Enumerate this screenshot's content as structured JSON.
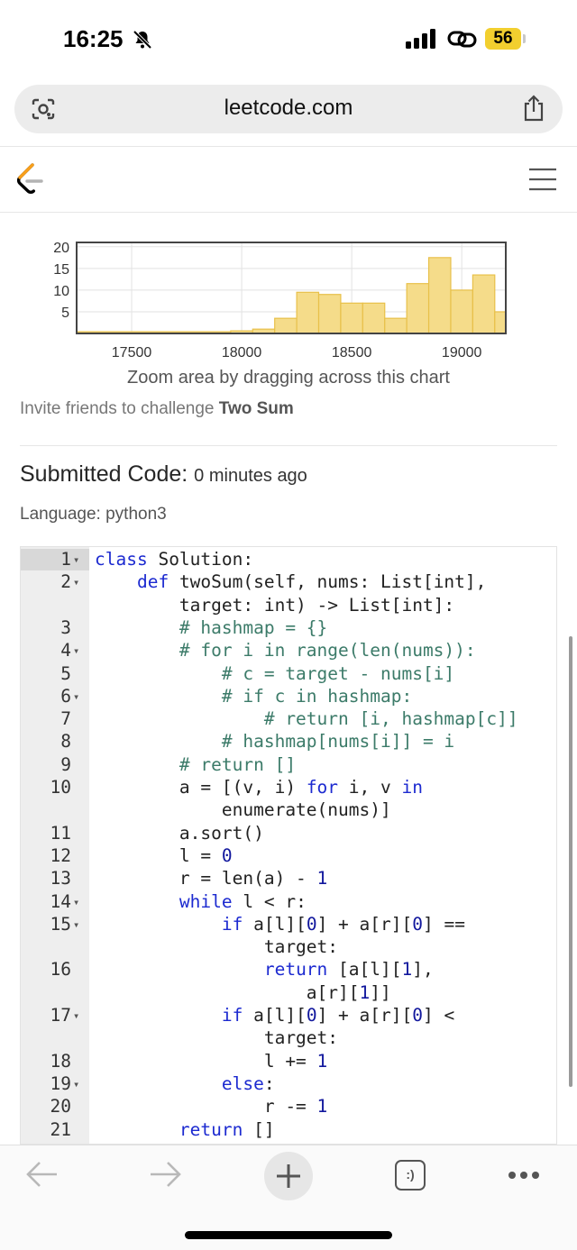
{
  "status_bar": {
    "time": "16:25",
    "battery": "56"
  },
  "browser": {
    "url": "leetcode.com"
  },
  "chart_data": {
    "type": "bar",
    "x_ticks": [
      17500,
      18000,
      18500,
      19000
    ],
    "y_ticks": [
      5,
      10,
      15,
      20
    ],
    "xlim": [
      17250,
      19200
    ],
    "ylim": [
      0,
      21
    ],
    "bins": [
      {
        "x0": 17250,
        "x1": 17950,
        "value": 0.4
      },
      {
        "x0": 17950,
        "x1": 18050,
        "value": 0.6
      },
      {
        "x0": 18050,
        "x1": 18150,
        "value": 1
      },
      {
        "x0": 18150,
        "x1": 18250,
        "value": 3.5
      },
      {
        "x0": 18250,
        "x1": 18350,
        "value": 9.5
      },
      {
        "x0": 18350,
        "x1": 18450,
        "value": 9
      },
      {
        "x0": 18450,
        "x1": 18550,
        "value": 7
      },
      {
        "x0": 18550,
        "x1": 18650,
        "value": 7
      },
      {
        "x0": 18650,
        "x1": 18750,
        "value": 3.5
      },
      {
        "x0": 18750,
        "x1": 18850,
        "value": 11.5
      },
      {
        "x0": 18850,
        "x1": 18950,
        "value": 17.5
      },
      {
        "x0": 18950,
        "x1": 19050,
        "value": 10
      },
      {
        "x0": 19050,
        "x1": 19150,
        "value": 13.5
      },
      {
        "x0": 19150,
        "x1": 19200,
        "value": 5
      }
    ],
    "bar_color": "#f5dc8a",
    "bar_stroke": "#e8c04a"
  },
  "chart_caption": "Zoom area by dragging across this chart",
  "invite": {
    "prefix": "Invite friends to challenge ",
    "problem": "Two Sum"
  },
  "submission": {
    "title": "Submitted Code:",
    "time": "0 minutes ago",
    "language": "Language: python3"
  },
  "code_lines": [
    {
      "n": "1",
      "fold": true,
      "segs": [
        [
          "kw",
          "class"
        ],
        [
          "",
          "Solution:"
        ]
      ]
    },
    {
      "n": "2",
      "fold": true,
      "segs": [
        [
          "",
          "    "
        ],
        [
          "kw",
          "def"
        ],
        [
          "",
          "twoSum(self, nums: List[int],"
        ]
      ]
    },
    {
      "n": "",
      "fold": false,
      "segs": [
        [
          "",
          "        target: int) -> List[int]:"
        ]
      ]
    },
    {
      "n": "3",
      "fold": false,
      "segs": [
        [
          "cm",
          "        # hashmap = {}"
        ]
      ]
    },
    {
      "n": "4",
      "fold": true,
      "segs": [
        [
          "cm",
          "        # for i in range(len(nums)):"
        ]
      ]
    },
    {
      "n": "5",
      "fold": false,
      "segs": [
        [
          "cm",
          "            # c = target - nums[i]"
        ]
      ]
    },
    {
      "n": "6",
      "fold": true,
      "segs": [
        [
          "cm",
          "            # if c in hashmap:"
        ]
      ]
    },
    {
      "n": "7",
      "fold": false,
      "segs": [
        [
          "cm",
          "                # return [i, hashmap[c]]"
        ]
      ]
    },
    {
      "n": "8",
      "fold": false,
      "segs": [
        [
          "cm",
          "            # hashmap[nums[i]] = i"
        ]
      ]
    },
    {
      "n": "9",
      "fold": false,
      "segs": [
        [
          "cm",
          "        # return []"
        ]
      ]
    },
    {
      "n": "10",
      "fold": false,
      "segs": [
        [
          "",
          "        a = [(v, i) "
        ],
        [
          "kw",
          "for"
        ],
        [
          "",
          " i, v "
        ],
        [
          "kw",
          "in"
        ]
      ]
    },
    {
      "n": "",
      "fold": false,
      "segs": [
        [
          "",
          "            enumerate(nums)]"
        ]
      ]
    },
    {
      "n": "11",
      "fold": false,
      "segs": [
        [
          "",
          "        a.sort()"
        ]
      ]
    },
    {
      "n": "12",
      "fold": false,
      "segs": [
        [
          "",
          "        l = "
        ],
        [
          "nm",
          "0"
        ]
      ]
    },
    {
      "n": "13",
      "fold": false,
      "segs": [
        [
          "",
          "        r = len(a) - "
        ],
        [
          "nm",
          "1"
        ]
      ]
    },
    {
      "n": "14",
      "fold": true,
      "segs": [
        [
          "",
          "        "
        ],
        [
          "kw",
          "while"
        ],
        [
          "",
          " l < r:"
        ]
      ]
    },
    {
      "n": "15",
      "fold": true,
      "segs": [
        [
          "",
          "            "
        ],
        [
          "kw",
          "if"
        ],
        [
          "",
          " a[l]["
        ],
        [
          "nm",
          "0"
        ],
        [
          "",
          "] + a[r]["
        ],
        [
          "nm",
          "0"
        ],
        [
          "",
          "] =="
        ]
      ]
    },
    {
      "n": "",
      "fold": false,
      "segs": [
        [
          "",
          "                target:"
        ]
      ]
    },
    {
      "n": "16",
      "fold": false,
      "segs": [
        [
          "",
          "                "
        ],
        [
          "kw",
          "return"
        ],
        [
          "",
          " [a[l]["
        ],
        [
          "nm",
          "1"
        ],
        [
          "",
          "],"
        ]
      ]
    },
    {
      "n": "",
      "fold": false,
      "segs": [
        [
          "",
          "                    a[r]["
        ],
        [
          "nm",
          "1"
        ],
        [
          "",
          "]]"
        ]
      ]
    },
    {
      "n": "17",
      "fold": true,
      "segs": [
        [
          "",
          "            "
        ],
        [
          "kw",
          "if"
        ],
        [
          "",
          " a[l]["
        ],
        [
          "nm",
          "0"
        ],
        [
          "",
          "] + a[r]["
        ],
        [
          "nm",
          "0"
        ],
        [
          "",
          "] <"
        ]
      ]
    },
    {
      "n": "",
      "fold": false,
      "segs": [
        [
          "",
          "                target:"
        ]
      ]
    },
    {
      "n": "18",
      "fold": false,
      "segs": [
        [
          "",
          "                l += "
        ],
        [
          "nm",
          "1"
        ]
      ]
    },
    {
      "n": "19",
      "fold": true,
      "segs": [
        [
          "",
          "            "
        ],
        [
          "kw",
          "else"
        ],
        [
          "",
          ":"
        ]
      ]
    },
    {
      "n": "20",
      "fold": false,
      "segs": [
        [
          "",
          "                r -= "
        ],
        [
          "nm",
          "1"
        ]
      ]
    },
    {
      "n": "21",
      "fold": false,
      "segs": [
        [
          "",
          "        "
        ],
        [
          "kw",
          "return"
        ],
        [
          "",
          " []"
        ]
      ]
    }
  ],
  "toolbar": {
    "tabs_label": ":)"
  }
}
